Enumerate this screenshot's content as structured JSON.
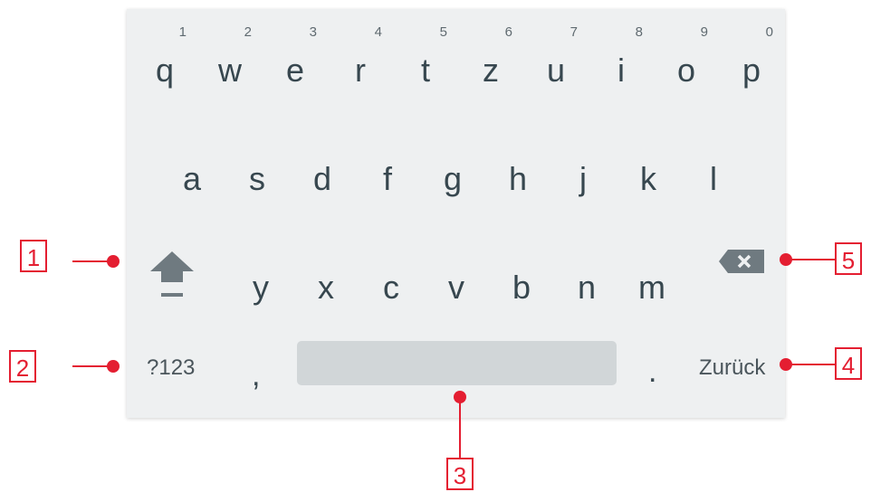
{
  "keyboard": {
    "row1": [
      {
        "key": "q",
        "hint": "1"
      },
      {
        "key": "w",
        "hint": "2"
      },
      {
        "key": "e",
        "hint": "3"
      },
      {
        "key": "r",
        "hint": "4"
      },
      {
        "key": "t",
        "hint": "5"
      },
      {
        "key": "z",
        "hint": "6"
      },
      {
        "key": "u",
        "hint": "7"
      },
      {
        "key": "i",
        "hint": "8"
      },
      {
        "key": "o",
        "hint": "9"
      },
      {
        "key": "p",
        "hint": "0"
      }
    ],
    "row2": [
      "a",
      "s",
      "d",
      "f",
      "g",
      "h",
      "j",
      "k",
      "l"
    ],
    "row3": [
      "y",
      "x",
      "c",
      "v",
      "b",
      "n",
      "m"
    ],
    "symbols_label": "?123",
    "comma": ",",
    "period": ".",
    "enter_label": "Zurück",
    "shift_icon": "shift-arrow-icon",
    "backspace_icon": "backspace-icon"
  },
  "callouts": [
    "1",
    "2",
    "3",
    "4",
    "5"
  ],
  "colors": {
    "accent": "#e41e31",
    "keyboard_bg": "#eef0f1",
    "key_text": "#37474f",
    "space_bar": "#d1d6d8"
  }
}
